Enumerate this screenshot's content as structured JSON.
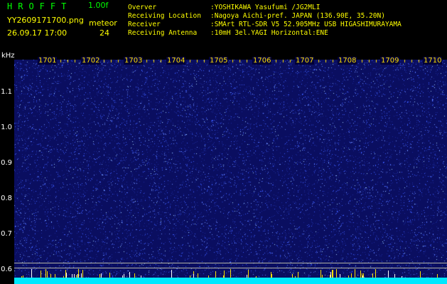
{
  "header": {
    "logo": "HROFFT",
    "version": "1.00f",
    "filename": "YY2609171700.png",
    "datetime": "26.09.17 17:00",
    "meteor_label": "meteor",
    "meteor_count": "24",
    "info": [
      {
        "key": "Overver",
        "value": ":YOSHIKAWA Yasufumi /JG2MLI"
      },
      {
        "key": "Receiving Location",
        "value": ":Nagoya Aichi-pref. JAPAN (136.90E, 35.20N)"
      },
      {
        "key": "Receiver",
        "value": ":SMArt RTL-SDR V5 52.905MHz USB HIGASHIMURAYAMA"
      },
      {
        "key": "Receiving Antenna",
        "value": ":10mH 3el.YAGI Horizontal:ENE"
      }
    ]
  },
  "spectrogram": {
    "y_unit": "kHz",
    "y_ticks": [
      "1.1",
      "1.0",
      "0.9",
      "0.8",
      "0.7",
      "0.6"
    ],
    "x_ticks": [
      "1701",
      "1702",
      "1703",
      "1704",
      "1705",
      "1706",
      "1707",
      "1708",
      "1709",
      "1710"
    ],
    "colors": {
      "background": "#000000",
      "noise_dark": "#0a0e60",
      "noise_bright": "#3c5cff",
      "speckle": "#9fd0ff",
      "label_yellow": "#ffe000",
      "bottom_band": "#00e8ff"
    }
  }
}
